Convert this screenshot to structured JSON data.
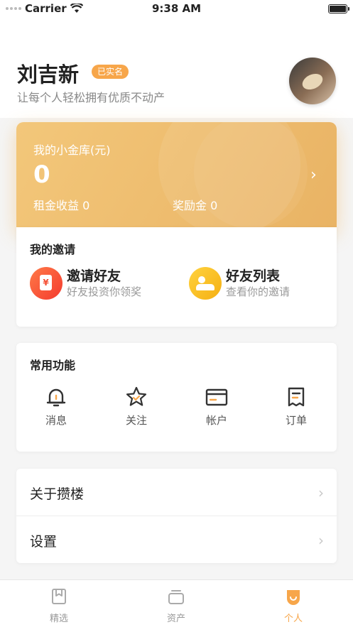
{
  "status_bar": {
    "carrier": "Carrier",
    "time": "9:38 AM"
  },
  "profile": {
    "name": "刘吉新",
    "verified_badge": "已实名",
    "slogan": "让每个人轻松拥有优质不动产"
  },
  "vault": {
    "title": "我的小金库(元)",
    "amount": "0",
    "rent_income": "租金收益 0",
    "bonus": "奖励金 0"
  },
  "invitation": {
    "section_title": "我的邀请",
    "items": [
      {
        "title": "邀请好友",
        "subtitle": "好友投资你领奖",
        "icon": "red-envelope-icon"
      },
      {
        "title": "好友列表",
        "subtitle": "查看你的邀请",
        "icon": "friends-icon"
      }
    ]
  },
  "functions": {
    "section_title": "常用功能",
    "items": [
      {
        "label": "消息",
        "icon": "bell-icon"
      },
      {
        "label": "关注",
        "icon": "star-icon"
      },
      {
        "label": "帐户",
        "icon": "card-icon"
      },
      {
        "label": "订单",
        "icon": "receipt-icon"
      }
    ]
  },
  "menu": [
    {
      "label": "关于攒楼"
    },
    {
      "label": "设置"
    }
  ],
  "tabbar": [
    {
      "label": "精选",
      "active": false
    },
    {
      "label": "资产",
      "active": false
    },
    {
      "label": "个人",
      "active": true
    }
  ],
  "colors": {
    "accent": "#f7a64a",
    "vault_gradient_start": "#f3c77a",
    "vault_gradient_end": "#e9b364"
  }
}
